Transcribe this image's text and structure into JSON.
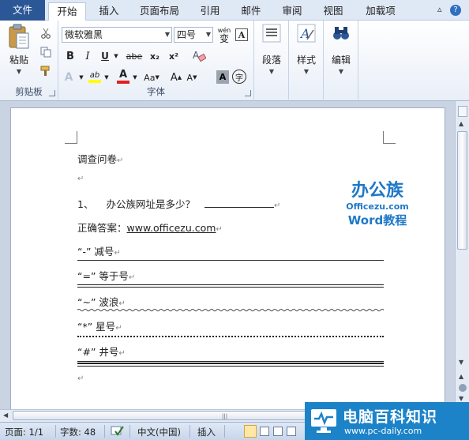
{
  "tabs": {
    "file": "文件",
    "home": "开始",
    "insert": "插入",
    "layout": "页面布局",
    "references": "引用",
    "mailings": "邮件",
    "review": "审阅",
    "view": "视图",
    "addins": "加载项"
  },
  "ribbon": {
    "clipboard": {
      "label": "剪贴板",
      "paste": "粘贴"
    },
    "font": {
      "label": "字体",
      "family": "微软雅黑",
      "size": "四号",
      "phonetic_top": "wén",
      "phonetic_char": "变",
      "bold": "B",
      "italic": "I",
      "underline": "U",
      "strike": "abe",
      "sub": "x₂",
      "sup": "x²",
      "grow": "A",
      "shrink": "A",
      "case": "Aa",
      "enclose": "字",
      "shade": "A",
      "border": "A"
    },
    "paragraph": {
      "label": "段落"
    },
    "styles": {
      "label": "样式"
    },
    "editing": {
      "label": "编辑"
    }
  },
  "document": {
    "title": "调查问卷",
    "q1_num": "1、",
    "q1_text": "办公族网址是多少？",
    "answer_label": "正确答案：",
    "answer_url": "www.officezu.com",
    "item1": "“-” 减号",
    "item2": "“=” 等于号",
    "item3": "“~” 波浪",
    "item4": "“*” 星号",
    "item5": "“#” 井号",
    "para_mark": "↵",
    "logo": {
      "top": "办公族",
      "mid": "Officezu.com",
      "bottom": "Word教程"
    }
  },
  "status": {
    "page": "页面: 1/1",
    "words": "字数: 48",
    "lang": "中文(中国)",
    "mode": "插入"
  },
  "watermark": {
    "title": "电脑百科知识",
    "url": "www.pc-daily.com"
  },
  "colors": {
    "file_tab": "#2b5797",
    "logo_blue": "#1e78c8",
    "watermark": "#1c83c9"
  }
}
